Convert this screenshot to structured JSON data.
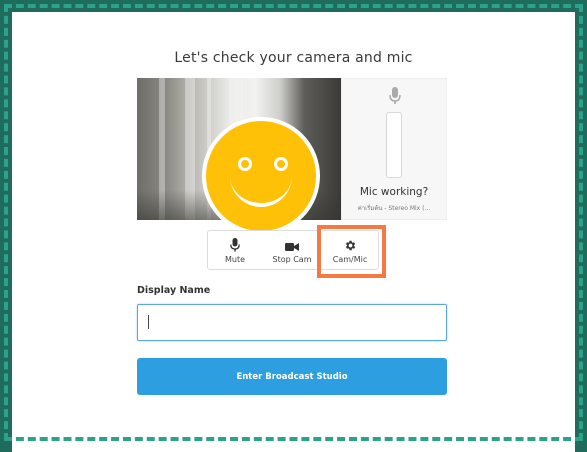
{
  "page": {
    "title": "Let's check your camera and mic"
  },
  "mic_panel": {
    "status": "Mic working?",
    "device": "ค่าเริ่มต้น - Stereo Mix (..."
  },
  "controls": [
    {
      "label": "Mute",
      "icon": "microphone-icon"
    },
    {
      "label": "Stop Cam",
      "icon": "video-camera-icon"
    },
    {
      "label": "Cam/Mic",
      "icon": "gear-icon"
    }
  ],
  "form": {
    "display_name_label": "Display Name",
    "display_name_value": "",
    "enter_button": "Enter Broadcast Studio"
  },
  "colors": {
    "accent": "#2d9ee0",
    "highlight": "#f47a42",
    "avatar": "#ffc107",
    "frame": "#2aa38a"
  }
}
